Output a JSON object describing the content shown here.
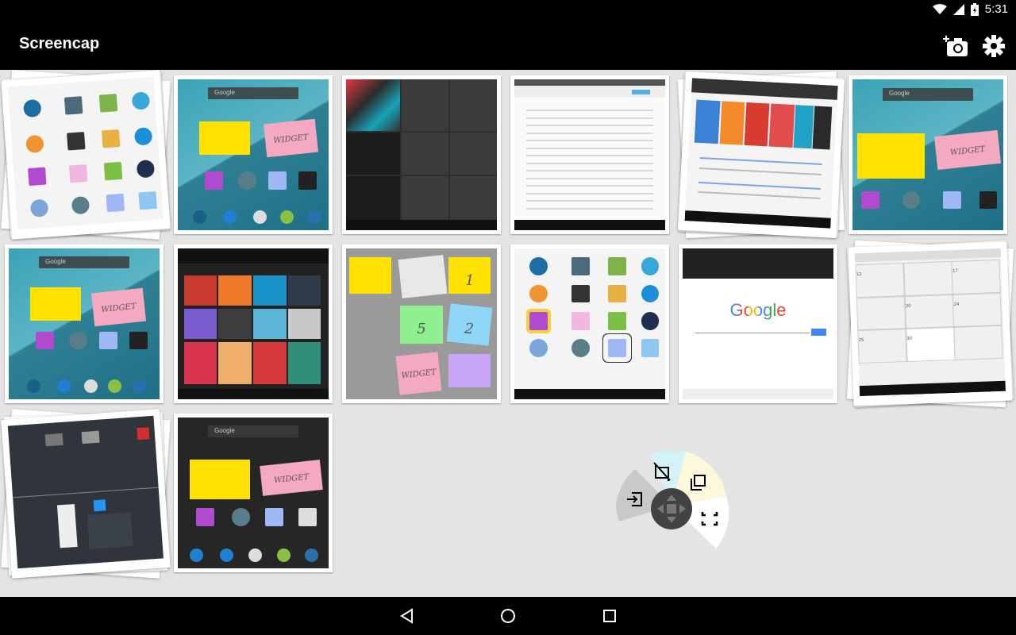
{
  "status_bar": {
    "time": "5:31"
  },
  "app_bar": {
    "title": "Screencap",
    "actions": [
      {
        "name": "add-screenshot-button",
        "icon": "camera-plus-icon"
      },
      {
        "name": "settings-button",
        "icon": "gear-icon"
      }
    ]
  },
  "thumbnails": [
    {
      "kind": "stack",
      "content": "app-drawer"
    },
    {
      "kind": "single",
      "content": "lollipop-home"
    },
    {
      "kind": "single",
      "content": "dark-tiles"
    },
    {
      "kind": "single",
      "content": "file-list"
    },
    {
      "kind": "stack",
      "content": "web-page"
    },
    {
      "kind": "single",
      "content": "lollipop-home-large"
    },
    {
      "kind": "single",
      "content": "lollipop-home"
    },
    {
      "kind": "single",
      "content": "wallpaper-grid"
    },
    {
      "kind": "single",
      "content": "sticky-notes"
    },
    {
      "kind": "single",
      "content": "app-drawer-annotated"
    },
    {
      "kind": "single",
      "content": "google-search"
    },
    {
      "kind": "stack",
      "content": "calendar"
    },
    {
      "kind": "stack",
      "content": "recents-dark"
    },
    {
      "kind": "single",
      "content": "dark-home"
    }
  ],
  "thumb_text": {
    "search_hint": "Google",
    "widget_label": "WIDGET",
    "google_logo": "Google",
    "note_1": "1",
    "note_2": "2",
    "note_5": "5",
    "calendar_numbers": [
      "20",
      "24",
      "25",
      "30",
      "17",
      "12"
    ]
  },
  "radial_menu": {
    "icons": [
      "crop-icon",
      "copy-icon",
      "fullscreen-icon",
      "exit-icon",
      "move-icon"
    ],
    "colors": {
      "crop": "#d4f3f6",
      "copy": "#fbf8dc",
      "fullscreen": "#ffffff",
      "exit": "#c9c9c9",
      "center": "#424242"
    }
  },
  "nav_bar": {
    "icons": [
      "back-icon",
      "home-icon",
      "recents-icon"
    ]
  },
  "colors": {
    "app_bar": "#000000",
    "background": "#e4e4e4"
  }
}
